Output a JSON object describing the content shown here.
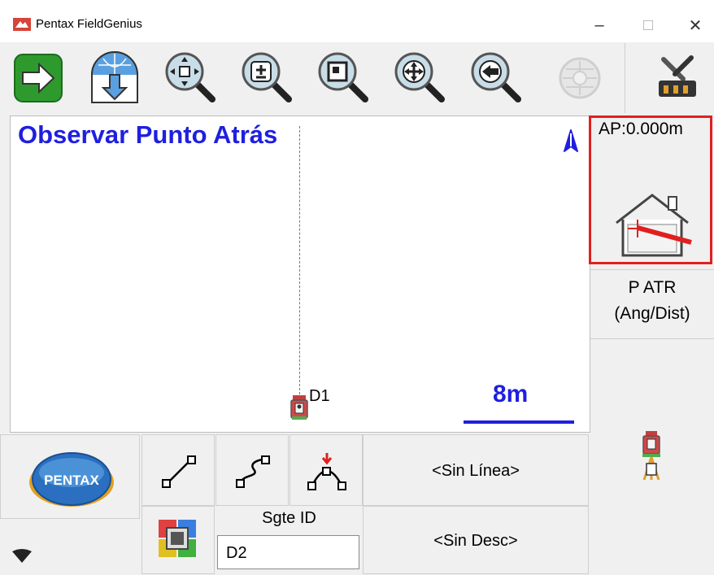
{
  "window": {
    "title": "Pentax FieldGenius",
    "minimize_symbol": "–",
    "maximize_symbol": "□",
    "close_symbol": "✕"
  },
  "toolbar": {
    "buttons": [
      {
        "name": "forward-arrow-icon"
      },
      {
        "name": "globe-download-icon"
      },
      {
        "name": "zoom-extents-icon"
      },
      {
        "name": "zoom-in-out-icon"
      },
      {
        "name": "zoom-window-icon"
      },
      {
        "name": "pan-icon"
      },
      {
        "name": "zoom-previous-icon"
      },
      {
        "name": "globe-disabled-icon"
      },
      {
        "name": "tools-settings-icon"
      }
    ]
  },
  "map": {
    "title": "Observar Punto Atrás",
    "point_label": "D1",
    "scale_label": "8m"
  },
  "right_panel": {
    "ap_label": "AP:0.000m",
    "mode_line1": "P ATR",
    "mode_line2": "(Ang/Dist)"
  },
  "bottom": {
    "line_label": "<Sin Línea>",
    "desc_label": "<Sin Desc>",
    "next_id_label": "Sgte ID",
    "next_id_value": "D2",
    "logo_text": "PENTAX"
  },
  "colors": {
    "accent_blue": "#1f1fe0",
    "highlight_red": "#e02020"
  }
}
